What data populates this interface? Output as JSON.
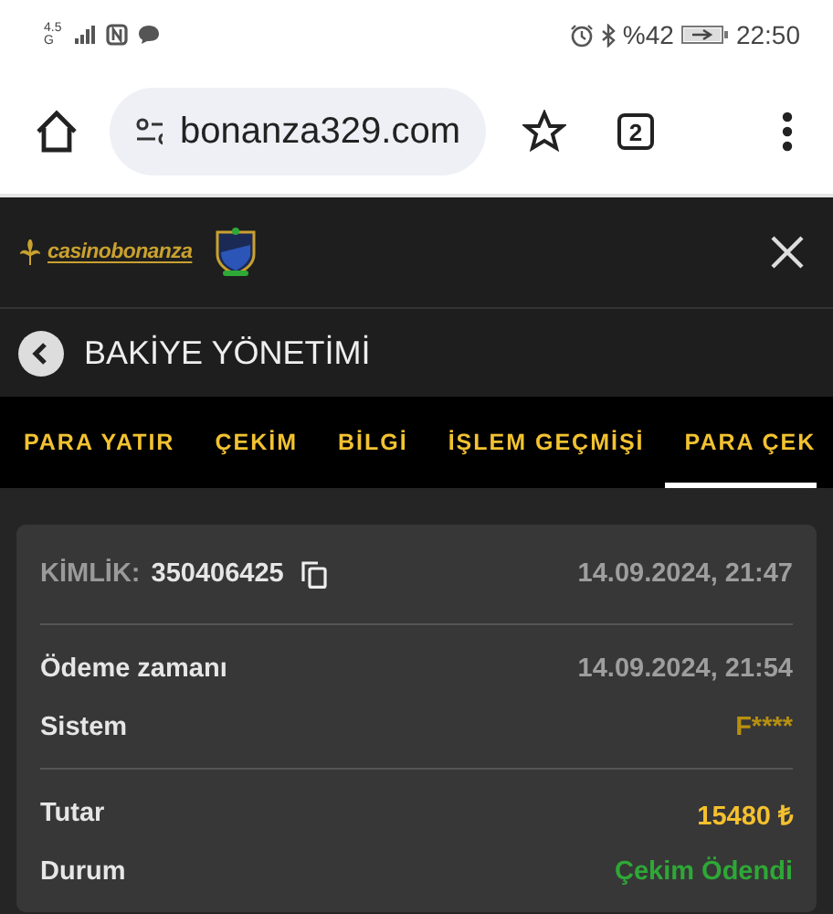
{
  "status_bar": {
    "network": "4.5G",
    "battery": "%42",
    "time": "22:50"
  },
  "browser": {
    "url": "bonanza329.com",
    "tab_count": "2"
  },
  "site": {
    "logo": "casinobonanza"
  },
  "page_title": "BAKİYE YÖNETİMİ",
  "tabs": [
    {
      "label": "PARA YATIR",
      "selected": false
    },
    {
      "label": "ÇEKİM",
      "selected": false
    },
    {
      "label": "BİLGİ",
      "selected": false
    },
    {
      "label": "İŞLEM GEÇMİŞİ",
      "selected": false
    },
    {
      "label": "PARA ÇEK",
      "selected": true
    }
  ],
  "card": {
    "id_label": "KİMLİK:",
    "id_value": "350406425",
    "created": "14.09.2024, 21:47",
    "groups": [
      [
        {
          "label": "Ödeme zamanı",
          "value": "14.09.2024, 21:54",
          "color": "#9e9e9e"
        },
        {
          "label": "Sistem",
          "value": "F****",
          "color": "#b8900e"
        }
      ],
      [
        {
          "label": "Tutar",
          "value": "15480 ₺",
          "color": "#f5c02e"
        },
        {
          "label": "Durum",
          "value": "Çekim Ödendi",
          "color": "#2ea836"
        }
      ]
    ]
  }
}
